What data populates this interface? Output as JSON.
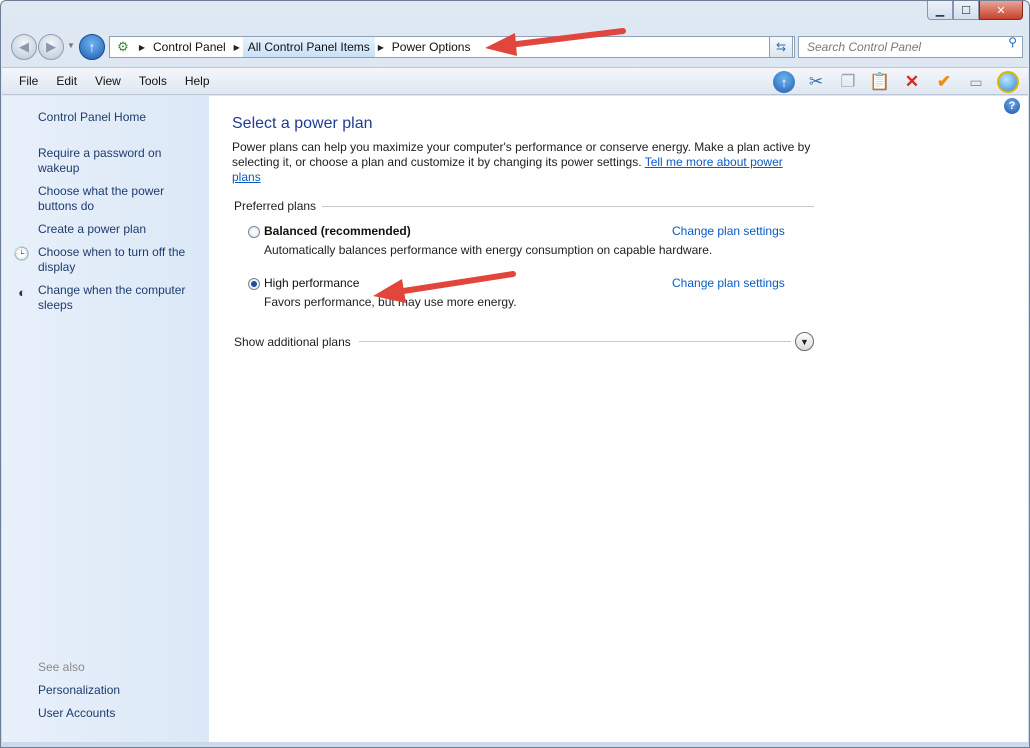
{
  "window": {
    "caption_buttons": {
      "minimize": "▁",
      "maximize": "☐",
      "close": "✕"
    }
  },
  "address_bar": {
    "breadcrumbs": [
      "Control Panel",
      "All Control Panel Items",
      "Power Options"
    ],
    "search_placeholder": "Search Control Panel"
  },
  "menu": [
    "File",
    "Edit",
    "View",
    "Tools",
    "Help"
  ],
  "toolbar_icons": [
    "up-icon",
    "cut-icon",
    "copy-icon",
    "paste-icon",
    "delete-icon",
    "checkmark-icon",
    "properties-icon",
    "shell-icon"
  ],
  "sidebar": {
    "home": "Control Panel Home",
    "links": [
      "Require a password on wakeup",
      "Choose what the power buttons do",
      "Create a power plan",
      "Choose when to turn off the display",
      "Change when the computer sleeps"
    ],
    "see_also_label": "See also",
    "see_also": [
      "Personalization",
      "User Accounts"
    ]
  },
  "main": {
    "title": "Select a power plan",
    "intro": "Power plans can help you maximize your computer's performance or conserve energy. Make a plan active by selecting it, or choose a plan and customize it by changing its power settings. ",
    "intro_link": "Tell me more about power plans",
    "group_label": "Preferred plans",
    "plans": [
      {
        "name": "Balanced (recommended)",
        "description": "Automatically balances performance with energy consumption on capable hardware.",
        "link": "Change plan settings",
        "selected": false
      },
      {
        "name": "High performance",
        "description": "Favors performance, but may use more energy.",
        "link": "Change plan settings",
        "selected": true
      }
    ],
    "show_more": "Show additional plans"
  },
  "colors": {
    "link": "#0a5bc4",
    "title": "#1e3c96",
    "sidebar_link": "#1e3c6e",
    "annotation_arrow": "#e2453c"
  }
}
